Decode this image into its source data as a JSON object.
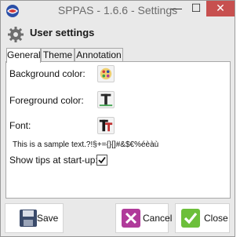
{
  "window": {
    "title": "SPPAS - 1.6.6 - Settings",
    "controls": {
      "minimize": "—",
      "maximize": "☐",
      "close": "✕"
    }
  },
  "header": {
    "title": "User settings",
    "icon": "gear-icon"
  },
  "tabs": [
    {
      "label": "General",
      "active": true
    },
    {
      "label": "Theme",
      "active": false
    },
    {
      "label": "Annotation",
      "active": false
    }
  ],
  "general": {
    "background_color_label": "Background color:",
    "foreground_color_label": "Foreground color:",
    "font_label": "Font:",
    "sample_text": "This is a sample text.?!§+={}[]#&$€%éèàù",
    "show_tips_label": "Show tips at start-up:",
    "show_tips_checked": true
  },
  "footer": {
    "save_label": "Save",
    "cancel_label": "Cancel",
    "close_label": "Close"
  },
  "colors": {
    "close_button": "#c7504f",
    "cancel_icon": "#b03a9a",
    "close_icon": "#6cbf3a",
    "save_icon": "#3a4a6a",
    "flag_blue": "#2b4fa8",
    "flag_red": "#d23a3a"
  }
}
